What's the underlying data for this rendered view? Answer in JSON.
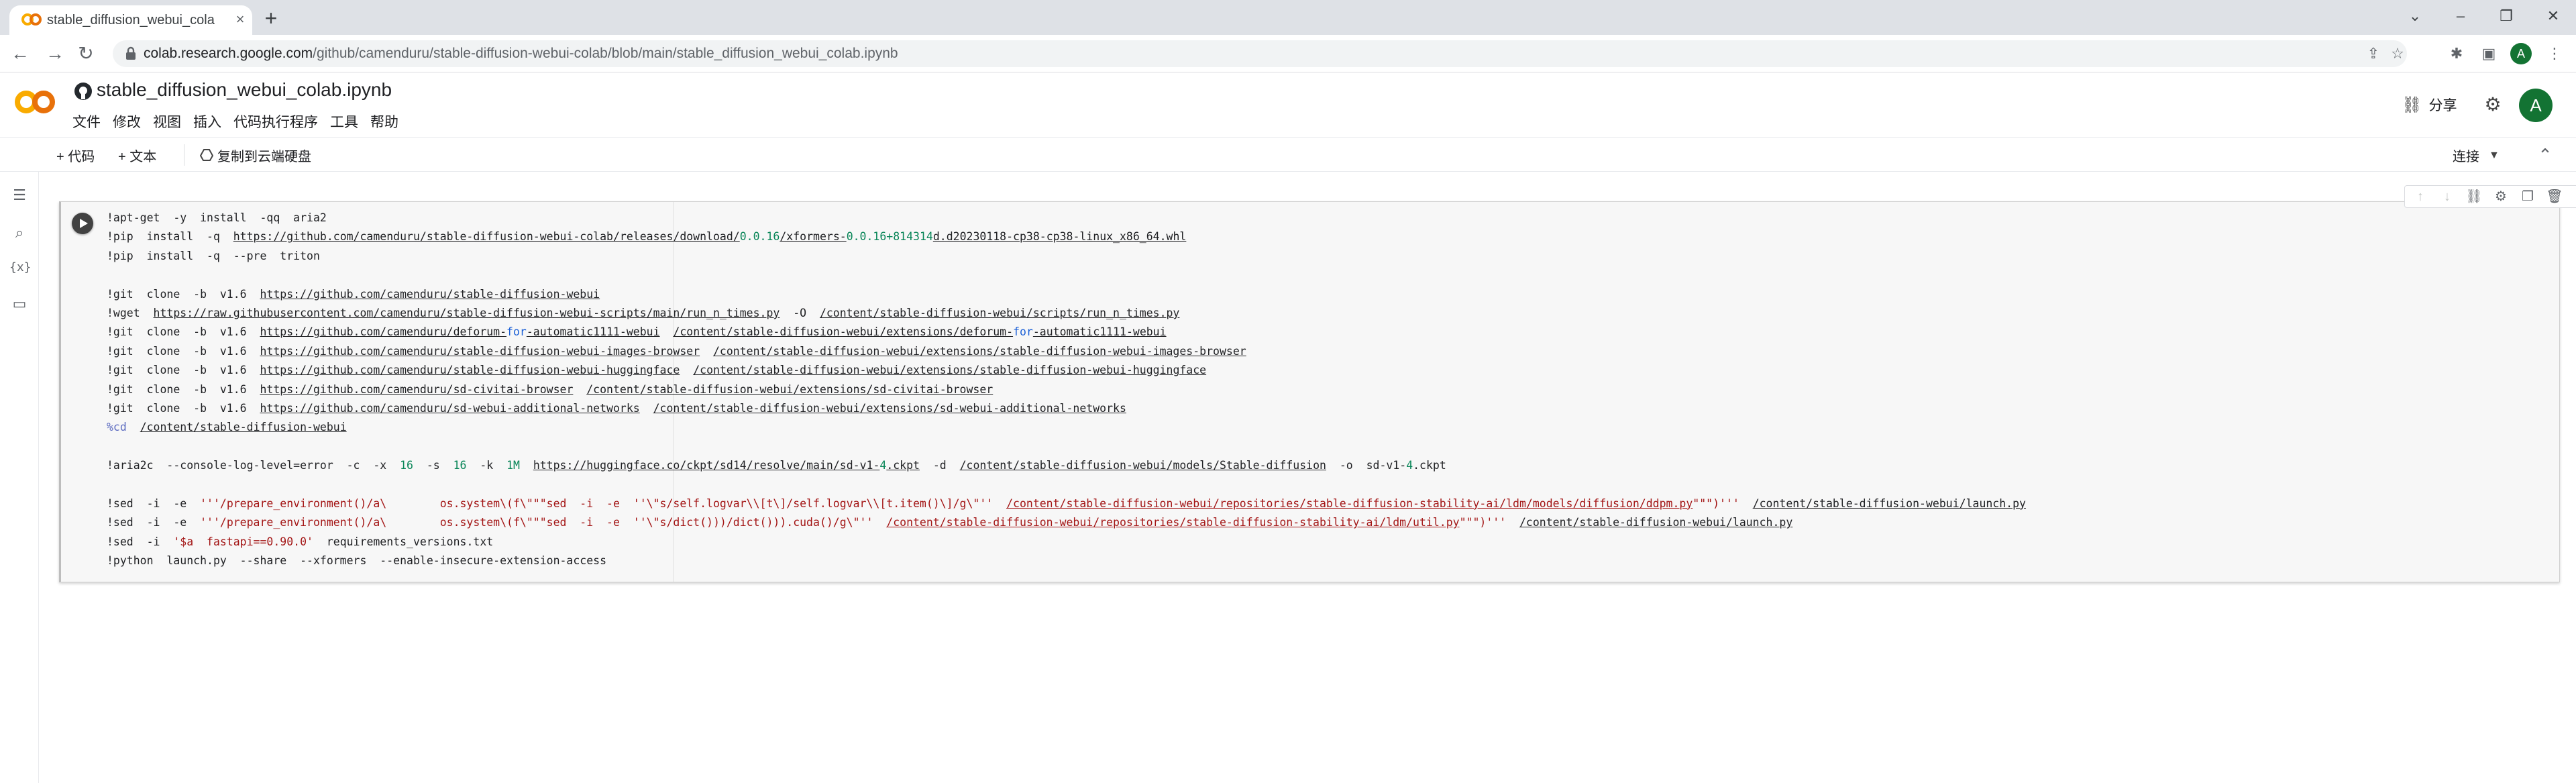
{
  "browser": {
    "tab_title": "stable_diffusion_webui_colab.i",
    "url_host": "colab.research.google.com",
    "url_path": "/github/camenduru/stable-diffusion-webui-colab/blob/main/stable_diffusion_webui_colab.ipynb",
    "profile_initial": "A"
  },
  "header": {
    "notebook_title": "stable_diffusion_webui_colab.ipynb",
    "menu": [
      "文件",
      "修改",
      "视图",
      "插入",
      "代码执行程序",
      "工具",
      "帮助"
    ],
    "share_label": "分享",
    "user_initial": "A"
  },
  "toolbar": {
    "add_code": "+ 代码",
    "add_text": "+ 文本",
    "copy_to_drive": "复制到云端硬盘",
    "connect": "连接"
  },
  "left_rail": {
    "vars_label": "{x}"
  },
  "cell": {
    "lines": [
      [
        {
          "t": "!apt-get  -y  install  -qq  aria2"
        }
      ],
      [
        {
          "t": "!pip  install  -q  "
        },
        {
          "t": "https://github.com/camenduru/stable-diffusion-webui-colab/releases/download/",
          "c": "link"
        },
        {
          "t": "0.0.16",
          "c": "num"
        },
        {
          "t": "/xformers-",
          "c": "link"
        },
        {
          "t": "0.0.16",
          "c": "num"
        },
        {
          "t": "+814314",
          "c": "num"
        },
        {
          "t": "d.d20230118-cp38-cp38-linux_x86_64.whl",
          "c": "link"
        }
      ],
      [
        {
          "t": "!pip  install  -q  --pre  triton"
        }
      ],
      [
        {
          "t": ""
        }
      ],
      [
        {
          "t": "!git  clone  -b  v1.6  "
        },
        {
          "t": "https://github.com/camenduru/stable-diffusion-webui",
          "c": "link"
        }
      ],
      [
        {
          "t": "!wget  "
        },
        {
          "t": "https://raw.githubusercontent.com/camenduru/stable-diffusion-webui-scripts/main/run_n_times.py",
          "c": "link"
        },
        {
          "t": "  -O  "
        },
        {
          "t": "/content/stable-diffusion-webui/scripts/run_n_times.py",
          "c": "link"
        }
      ],
      [
        {
          "t": "!git  clone  -b  v1.6  "
        },
        {
          "t": "https://github.com/camenduru/deforum-",
          "c": "link"
        },
        {
          "t": "for",
          "c": "kw"
        },
        {
          "t": "-automatic1111-webui",
          "c": "link"
        },
        {
          "t": "  "
        },
        {
          "t": "/content/stable-diffusion-webui/extensions/deforum-",
          "c": "link"
        },
        {
          "t": "for",
          "c": "kw"
        },
        {
          "t": "-automatic1111-webui",
          "c": "link"
        }
      ],
      [
        {
          "t": "!git  clone  -b  v1.6  "
        },
        {
          "t": "https://github.com/camenduru/stable-diffusion-webui-images-browser",
          "c": "link"
        },
        {
          "t": "  "
        },
        {
          "t": "/content/stable-diffusion-webui/extensions/stable-diffusion-webui-images-browser",
          "c": "link"
        }
      ],
      [
        {
          "t": "!git  clone  -b  v1.6  "
        },
        {
          "t": "https://github.com/camenduru/stable-diffusion-webui-huggingface",
          "c": "link"
        },
        {
          "t": "  "
        },
        {
          "t": "/content/stable-diffusion-webui/extensions/stable-diffusion-webui-huggingface",
          "c": "link"
        }
      ],
      [
        {
          "t": "!git  clone  -b  v1.6  "
        },
        {
          "t": "https://github.com/camenduru/sd-civitai-browser",
          "c": "link"
        },
        {
          "t": "  "
        },
        {
          "t": "/content/stable-diffusion-webui/extensions/sd-civitai-browser",
          "c": "link"
        }
      ],
      [
        {
          "t": "!git  clone  -b  v1.6  "
        },
        {
          "t": "https://github.com/camenduru/sd-webui-additional-networks",
          "c": "link"
        },
        {
          "t": "  "
        },
        {
          "t": "/content/stable-diffusion-webui/extensions/sd-webui-additional-networks",
          "c": "link"
        }
      ],
      [
        {
          "t": "%cd",
          "c": "magic"
        },
        {
          "t": "  "
        },
        {
          "t": "/content/stable-diffusion-webui",
          "c": "link"
        }
      ],
      [
        {
          "t": ""
        }
      ],
      [
        {
          "t": "!aria2c  --console-log-level=error  -c  -x  "
        },
        {
          "t": "16",
          "c": "num"
        },
        {
          "t": "  -s  "
        },
        {
          "t": "16",
          "c": "num"
        },
        {
          "t": "  -k  "
        },
        {
          "t": "1M",
          "c": "num"
        },
        {
          "t": "  "
        },
        {
          "t": "https://huggingface.co/ckpt/sd14/resolve/main/sd-v1-",
          "c": "link"
        },
        {
          "t": "4",
          "c": "num"
        },
        {
          "t": ".ckpt",
          "c": "link"
        },
        {
          "t": "  -d  "
        },
        {
          "t": "/content/stable-diffusion-webui/models/Stable-diffusion",
          "c": "link"
        },
        {
          "t": "  -o  sd-v1-"
        },
        {
          "t": "4",
          "c": "num"
        },
        {
          "t": ".ckpt"
        }
      ],
      [
        {
          "t": ""
        }
      ],
      [
        {
          "t": "!sed  -i  -e  "
        },
        {
          "t": "'''/prepare_environment()/a\\        os.system\\(f\\\"\"\"sed  -i  -e  ''\\\"s/self.logvar\\\\[t\\]/self.logvar\\\\[t.item()\\]/g\\\"''  ",
          "c": "str"
        },
        {
          "t": "/content/stable-diffusion-webui/repositories/stable-diffusion-stability-ai/ldm/models/diffusion/ddpm.py",
          "c": "strlink"
        },
        {
          "t": "\"\"\")'''",
          "c": "str"
        },
        {
          "t": "  "
        },
        {
          "t": "/content/stable-diffusion-webui/launch.py",
          "c": "link"
        }
      ],
      [
        {
          "t": "!sed  -i  -e  "
        },
        {
          "t": "'''/prepare_environment()/a\\        os.system\\(f\\\"\"\"sed  -i  -e  ''\\\"s/dict()))/dict())).cuda()/g\\\"''  ",
          "c": "str"
        },
        {
          "t": "/content/stable-diffusion-webui/repositories/stable-diffusion-stability-ai/ldm/util.py",
          "c": "strlink"
        },
        {
          "t": "\"\"\")'''",
          "c": "str"
        },
        {
          "t": "  "
        },
        {
          "t": "/content/stable-diffusion-webui/launch.py",
          "c": "link"
        }
      ],
      [
        {
          "t": "!sed  -i  "
        },
        {
          "t": "'$a  fastapi==0.90.0'",
          "c": "str"
        },
        {
          "t": "  requirements_versions.txt"
        }
      ],
      [
        {
          "t": "!python  launch.py  --share  --xformers  --enable-insecure-extension-access"
        }
      ]
    ]
  },
  "colors": {
    "accent": "#1a73e8",
    "colab_orange": "#f9ab00",
    "colab_orange_dark": "#e8710a"
  }
}
